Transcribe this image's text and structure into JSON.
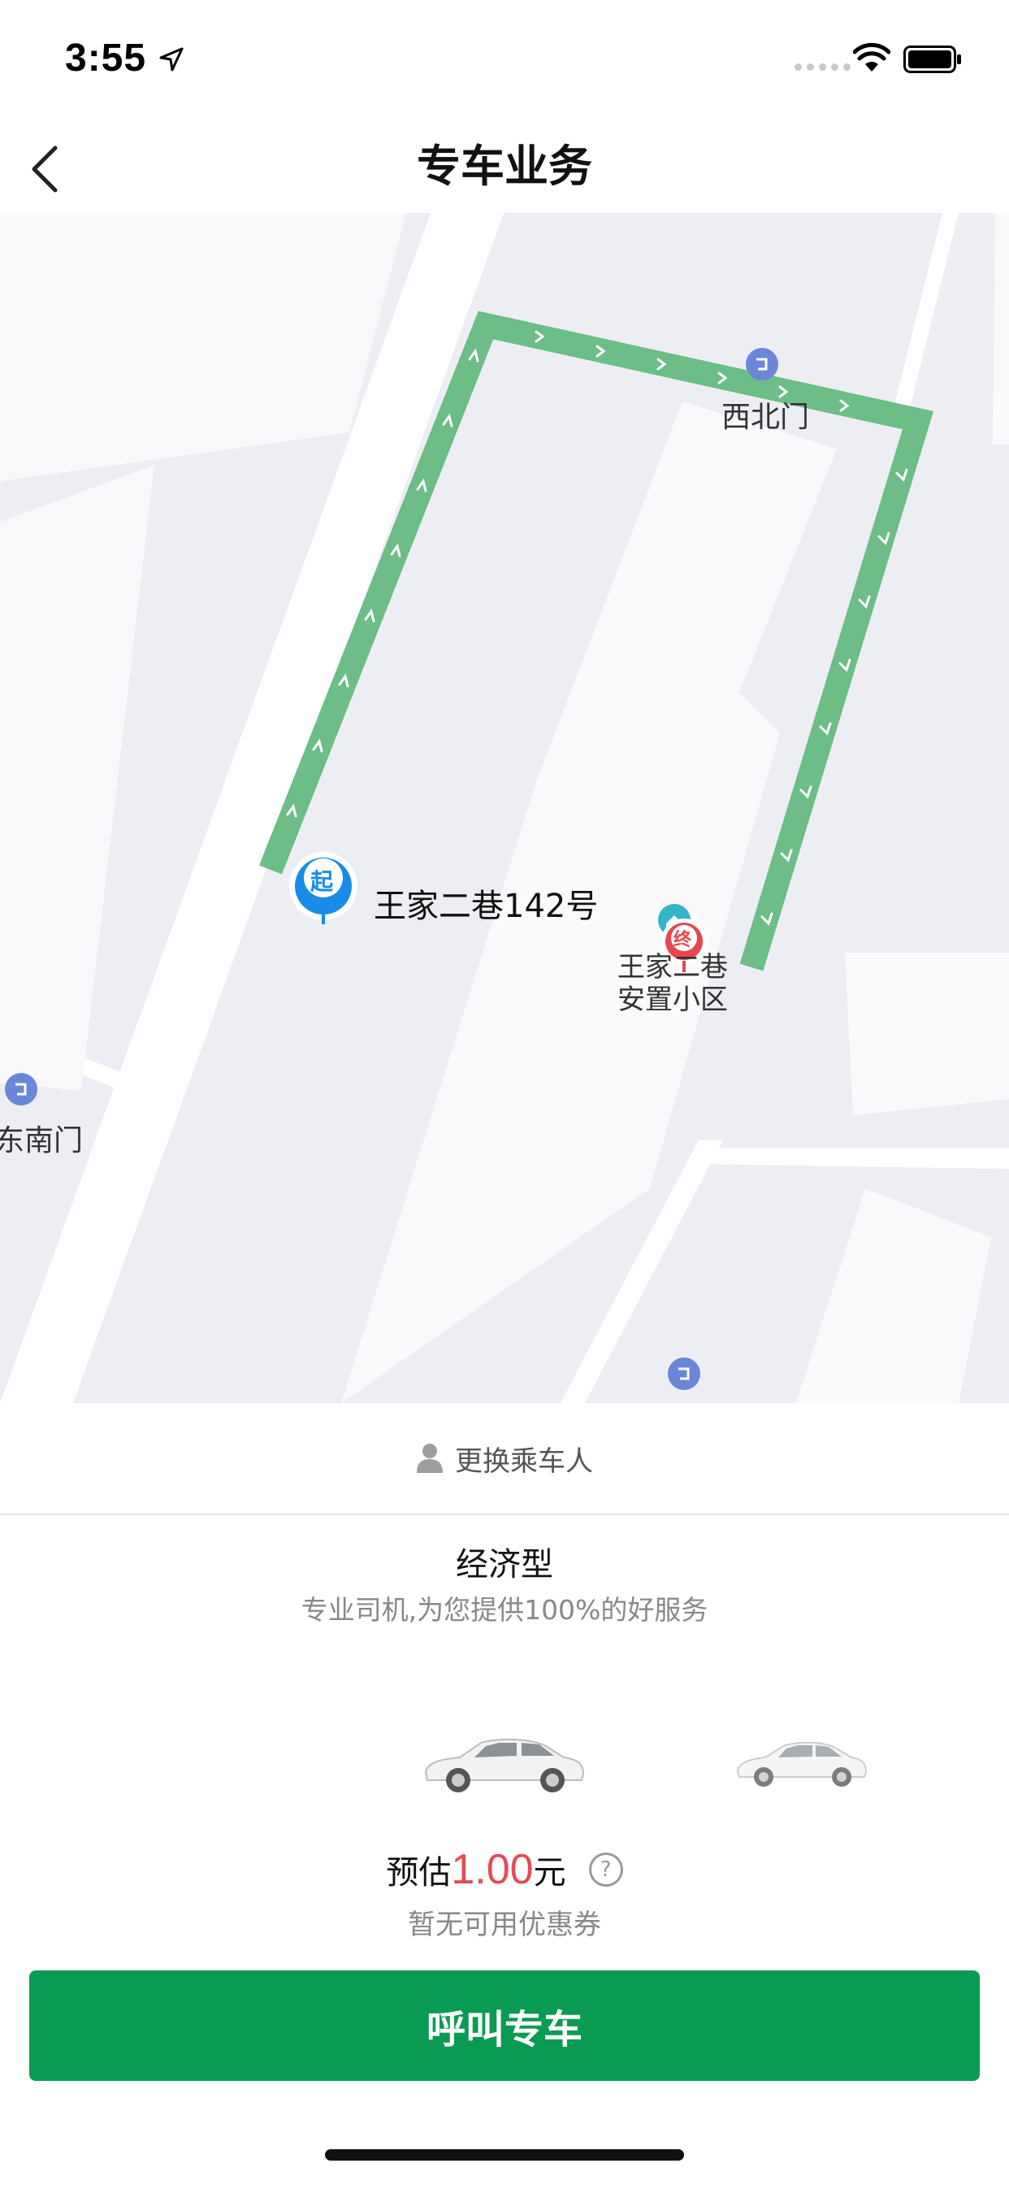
{
  "status_bar": {
    "time": "3:55"
  },
  "nav": {
    "title": "专车业务"
  },
  "map": {
    "start_badge": "起",
    "end_badge": "终",
    "start_address": "王家二巷142号",
    "destination_line1": "王家二巷",
    "destination_line2": "安置小区",
    "poi_northwest_gate": "西北门",
    "poi_southeast_gate": "东南门"
  },
  "passenger": {
    "label": "更换乘车人"
  },
  "car": {
    "type": "经济型",
    "description": "专业司机,为您提供100%的好服务"
  },
  "estimate": {
    "prefix": "预估",
    "price": "1.00",
    "suffix": "元",
    "help_symbol": "?",
    "coupon_text": "暂无可用优惠券"
  },
  "action": {
    "call_button": "呼叫专车"
  },
  "colors": {
    "accent_green": "#0a9b53",
    "route_green": "#6cbd86",
    "price_red": "#e34b56"
  }
}
